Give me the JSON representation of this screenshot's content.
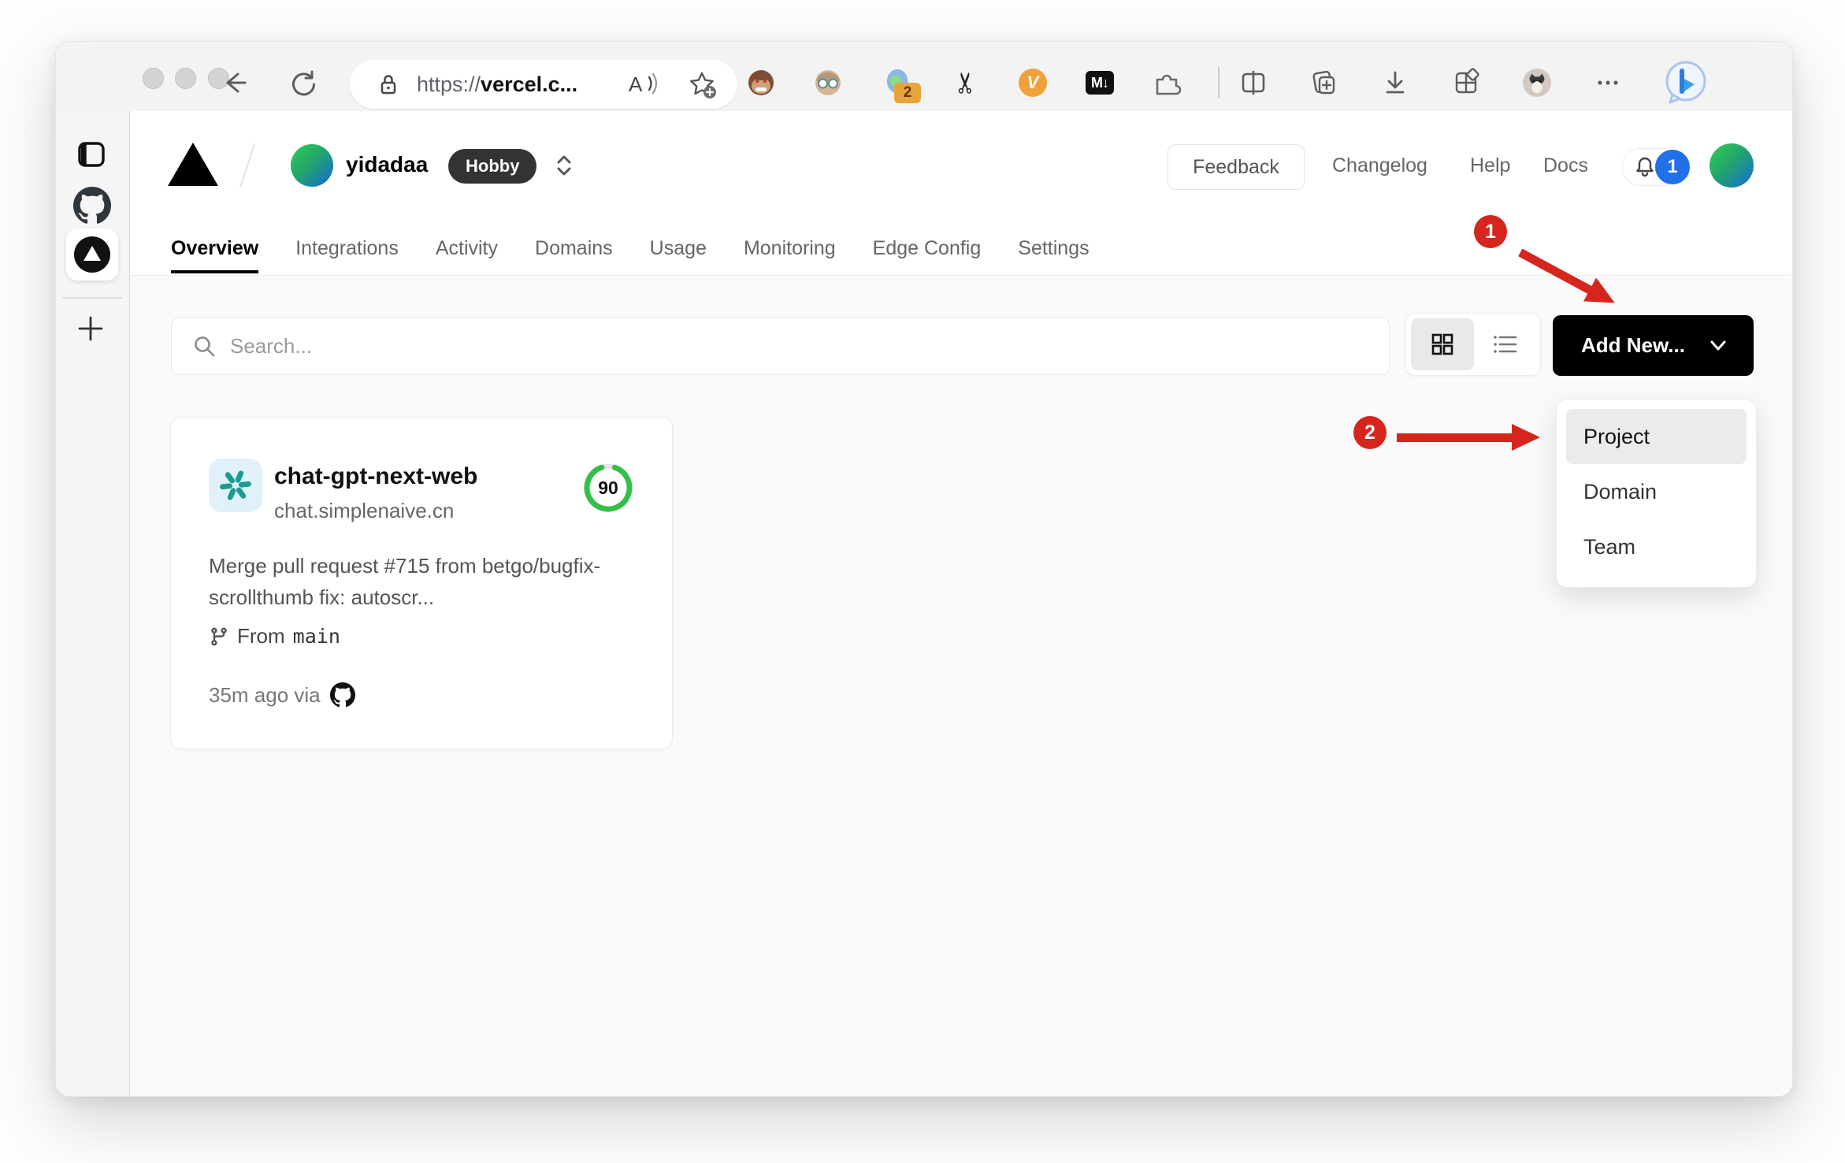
{
  "browser": {
    "url_prefix": "https://",
    "url_host": "vercel.c...",
    "extensions": {
      "glarity_badge": "2",
      "v_label": "V",
      "markdown_label": "M↓"
    }
  },
  "header": {
    "team": "yidadaa",
    "plan_badge": "Hobby",
    "feedback": "Feedback",
    "links": [
      "Changelog",
      "Help",
      "Docs"
    ],
    "notification_count": "1"
  },
  "tabs": [
    "Overview",
    "Integrations",
    "Activity",
    "Domains",
    "Usage",
    "Monitoring",
    "Edge Config",
    "Settings"
  ],
  "toolbar": {
    "search_placeholder": "Search...",
    "add_new": "Add New..."
  },
  "dropdown": {
    "items": [
      "Project",
      "Domain",
      "Team"
    ]
  },
  "project_card": {
    "name": "chat-gpt-next-web",
    "domain": "chat.simplenaive.cn",
    "score": "90",
    "commit": "Merge pull request #715 from betgo/bugfix-scrollthumb fix: autoscr...",
    "from_label": "From",
    "branch": "main",
    "deployed": "35m ago via"
  },
  "annotations": {
    "step1": "1",
    "step2": "2"
  },
  "colors": {
    "accent_red": "#d5251d",
    "score_green": "#34bf49",
    "badge_blue": "#2170e8"
  }
}
